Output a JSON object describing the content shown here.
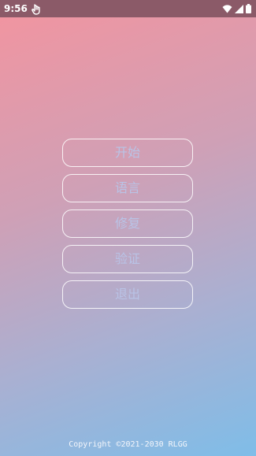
{
  "status_bar": {
    "time": "9:56",
    "app_icon": "hand-touch-icon",
    "wifi_icon": "wifi-icon",
    "signal_icon": "cell-signal-icon",
    "battery_icon": "battery-icon"
  },
  "menu": {
    "start_label": "开始",
    "language_label": "语言",
    "repair_label": "修复",
    "verify_label": "验证",
    "exit_label": "退出"
  },
  "footer": {
    "copyright": "Copyright ©2021-2030 RLGG"
  },
  "colors": {
    "status_bar": "#8b5a68",
    "gradient_start": "#f3949f",
    "gradient_end": "#7fbde8",
    "button_text": "#b9c3e6"
  }
}
